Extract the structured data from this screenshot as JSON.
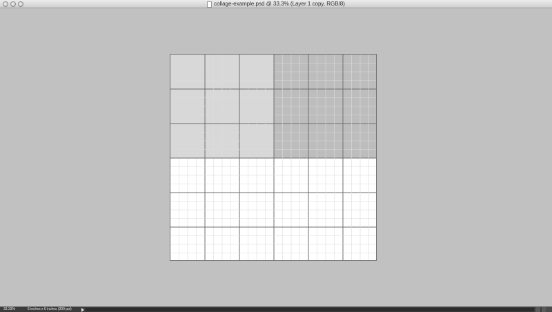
{
  "window": {
    "title": "collage-example.psd @ 33.3% (Layer 1 copy, RGB/8)"
  },
  "document": {
    "background_color": "#ffffff",
    "light_block_color": "#d8d8d8",
    "dark_block_color": "#bdbdbd",
    "major_grid_color": "#6e6e6e",
    "minor_grid_color": "#dcdcdc",
    "major_divisions": 6,
    "minor_subdivisions": 4
  },
  "statusbar": {
    "zoom": "33.33%",
    "doc_info": "6 inches x 6 inches (300 ppi)"
  },
  "icons": {
    "close": "close-icon",
    "minimize": "minimize-icon",
    "zoom": "zoom-icon",
    "document": "document-icon",
    "status_menu": "triangle-right-icon"
  }
}
